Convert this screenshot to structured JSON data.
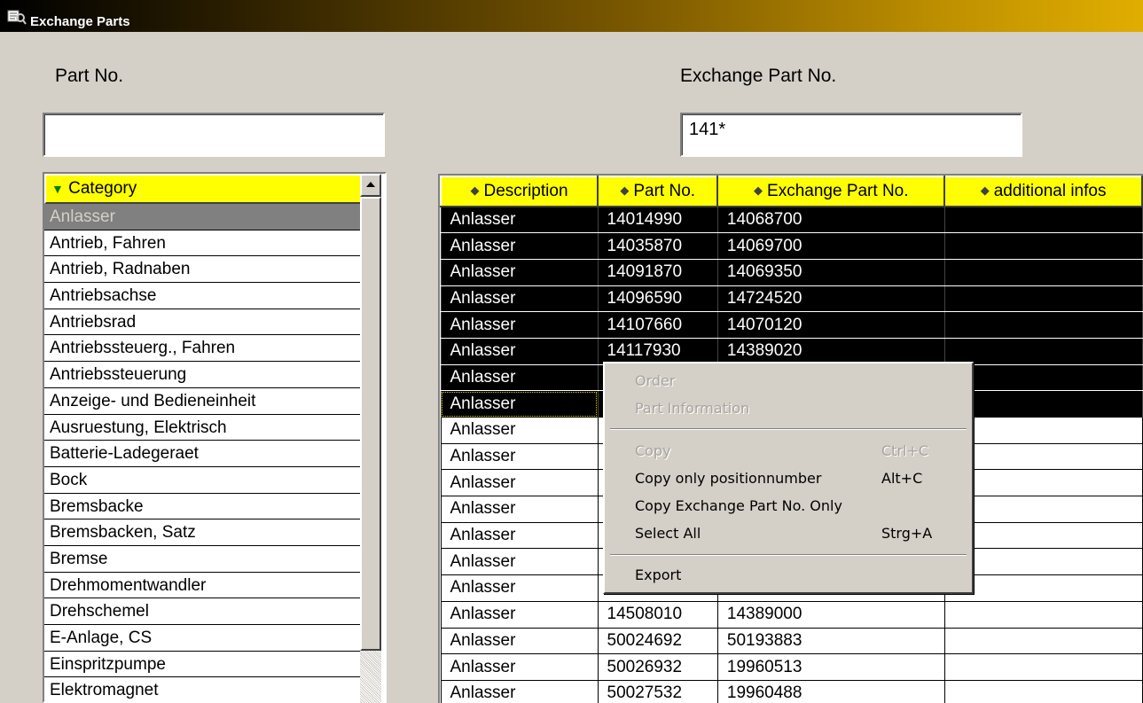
{
  "window": {
    "title": "Exchange Parts"
  },
  "filters": {
    "part_no_label": "Part No.",
    "part_no_value": "",
    "exchange_part_no_label": "Exchange Part No.",
    "exchange_part_no_value": "141*"
  },
  "category_list": {
    "header": "Category",
    "header_arrow": "▼",
    "items": [
      "Anlasser",
      "Antrieb, Fahren",
      "Antrieb, Radnaben",
      "Antriebsachse",
      "Antriebsrad",
      "Antriebssteuerg., Fahren",
      "Antriebssteuerung",
      "Anzeige- und Bedieneinheit",
      "Ausruestung, Elektrisch",
      "Batterie-Ladegeraet",
      "Bock",
      "Bremsbacke",
      "Bremsbacken, Satz",
      "Bremse",
      "Drehmomentwandler",
      "Drehschemel",
      "E-Anlage, CS",
      "Einspritzpumpe",
      "Elektromagnet"
    ],
    "selected_index": 0
  },
  "parts_grid": {
    "columns": [
      "Description",
      "Part No.",
      "Exchange Part No.",
      "additional infos"
    ],
    "rows": [
      [
        "Anlasser",
        "14014990",
        "14068700",
        ""
      ],
      [
        "Anlasser",
        "14035870",
        "14069700",
        ""
      ],
      [
        "Anlasser",
        "14091870",
        "14069350",
        ""
      ],
      [
        "Anlasser",
        "14096590",
        "14724520",
        ""
      ],
      [
        "Anlasser",
        "14107660",
        "14070120",
        ""
      ],
      [
        "Anlasser",
        "14117930",
        "14389020",
        ""
      ],
      [
        "Anlasser",
        "",
        "",
        ""
      ],
      [
        "Anlasser",
        "",
        "",
        ""
      ],
      [
        "Anlasser",
        "",
        "",
        ""
      ],
      [
        "Anlasser",
        "",
        "",
        ""
      ],
      [
        "Anlasser",
        "",
        "",
        ""
      ],
      [
        "Anlasser",
        "",
        "",
        ""
      ],
      [
        "Anlasser",
        "",
        "",
        ""
      ],
      [
        "Anlasser",
        "",
        "",
        ""
      ],
      [
        "Anlasser",
        "",
        "",
        ""
      ],
      [
        "Anlasser",
        "14508010",
        "14389000",
        ""
      ],
      [
        "Anlasser",
        "50024692",
        "50193883",
        ""
      ],
      [
        "Anlasser",
        "50026932",
        "19960513",
        ""
      ],
      [
        "Anlasser",
        "50027532",
        "19960488",
        ""
      ]
    ],
    "selected_rows": 8,
    "focused_row": 7
  },
  "context_menu": {
    "items": [
      {
        "label": "Order",
        "shortcut": "",
        "enabled": false
      },
      {
        "label": "Part Information",
        "shortcut": "",
        "enabled": false
      },
      {
        "label": "Copy",
        "shortcut": "Ctrl+C",
        "enabled": false
      },
      {
        "label": "Copy only positionnumber",
        "shortcut": "Alt+C",
        "enabled": true
      },
      {
        "label": "Copy Exchange Part No. Only",
        "shortcut": "",
        "enabled": true
      },
      {
        "label": "Select All",
        "shortcut": "Strg+A",
        "enabled": true
      },
      {
        "label": "Export",
        "shortcut": "",
        "enabled": true
      }
    ]
  },
  "icons": {
    "diamond": "◆",
    "app": "parts-catalog-icon"
  }
}
